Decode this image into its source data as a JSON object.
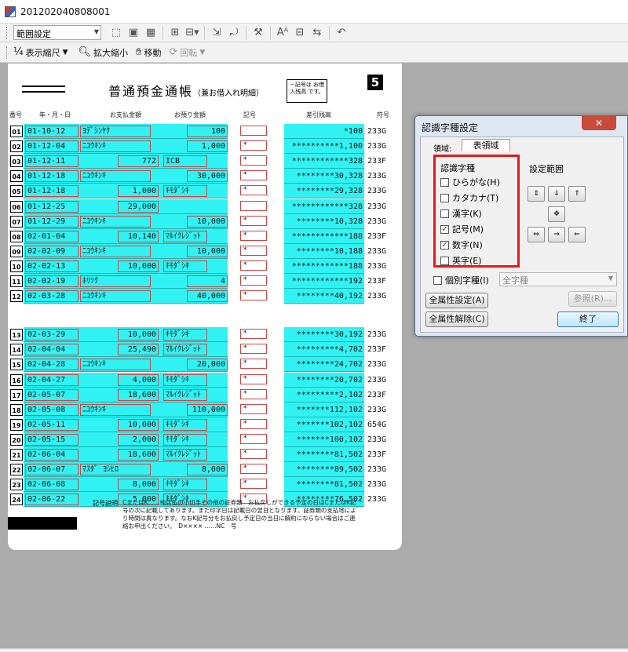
{
  "window": {
    "title": "201202040808001"
  },
  "toolbar1": {
    "range_select": "範囲設定"
  },
  "toolbar2": {
    "display_scale": "表示縮尺",
    "zoom": "拡大縮小",
    "move": "移動",
    "rotate": "回転"
  },
  "document": {
    "title": "普通預金通帳",
    "subtitle": "（兼お借入れ明細）",
    "note_box": "－記号は お借入残高 です。",
    "page_number": "5",
    "headers": {
      "num": "番号",
      "date": "年・月・日",
      "desc": "お支払金額",
      "deposit": "お預り金額",
      "mark": "記号",
      "balance": "差引残高",
      "code": "符号"
    },
    "rows": [
      {
        "n": "01",
        "date": "01-10-12",
        "desc1": "ﾖﾃﾞｼﾝﾔｸ",
        "amt1": "",
        "desc2": "",
        "amt2": "100",
        "mark": "",
        "balance": "*100",
        "code": "233G"
      },
      {
        "n": "02",
        "date": "01-12-04",
        "desc1": "ﾆﾕｳｷﾝｷ",
        "amt1": "",
        "desc2": "",
        "amt2": "1,000",
        "mark": "*",
        "balance": "**********1,100",
        "code": "233G"
      },
      {
        "n": "03",
        "date": "01-12-11",
        "desc1": "",
        "amt1": "772",
        "desc2": "ICB",
        "amt2": "",
        "mark": "*",
        "balance": "************328",
        "code": "233F"
      },
      {
        "n": "04",
        "date": "01-12-18",
        "desc1": "ﾆﾕｳｷﾝｷ",
        "amt1": "",
        "desc2": "",
        "amt2": "30,000",
        "mark": "*",
        "balance": "********30,328",
        "code": "233G"
      },
      {
        "n": "05",
        "date": "01-12-18",
        "desc1": "",
        "amt1": "1,000",
        "desc2": "ｷﾓﾀﾞｼｷ",
        "amt2": "",
        "mark": "*",
        "balance": "********29,328",
        "code": "233G"
      },
      {
        "n": "06",
        "date": "01-12-25",
        "desc1": "",
        "amt1": "29,000",
        "desc2": "",
        "amt2": "",
        "mark": "",
        "balance": "************328",
        "code": "233G"
      },
      {
        "n": "07",
        "date": "01-12-29",
        "desc1": "ﾆﾕｳｷﾝｷ",
        "amt1": "",
        "desc2": "",
        "amt2": "10,000",
        "mark": "*",
        "balance": "********10,328",
        "code": "233G"
      },
      {
        "n": "08",
        "date": "02-01-04",
        "desc1": "",
        "amt1": "10,140",
        "desc2": "ﾏﾙｲｸﾚｼﾞｯﾄ",
        "amt2": "",
        "mark": "*",
        "balance": "************188",
        "code": "233F"
      },
      {
        "n": "09",
        "date": "02-02-09",
        "desc1": "ﾆﾕｳｷﾝｷ",
        "amt1": "",
        "desc2": "",
        "amt2": "10,000",
        "mark": "*",
        "balance": "********10,188",
        "code": "233G"
      },
      {
        "n": "10",
        "date": "02-02-13",
        "desc1": "",
        "amt1": "10,000",
        "desc2": "ｷﾓﾀﾞｼｷ",
        "amt2": "",
        "mark": "*",
        "balance": "************188",
        "code": "233G"
      },
      {
        "n": "11",
        "date": "02-02-19",
        "desc1": "ﾎﾘｿｸ",
        "amt1": "",
        "desc2": "",
        "amt2": "4",
        "mark": "*",
        "balance": "************192",
        "code": "233F"
      },
      {
        "n": "12",
        "date": "02-03-28",
        "desc1": "ﾆﾕｳｷﾝｷ",
        "amt1": "",
        "desc2": "",
        "amt2": "40,000",
        "mark": "*",
        "balance": "********40,192",
        "code": "233G"
      },
      {
        "n": "13",
        "date": "02-03-29",
        "desc1": "",
        "amt1": "10,000",
        "desc2": "ｷﾓﾀﾞｼｷ",
        "amt2": "",
        "mark": "*",
        "balance": "********30,192",
        "code": "233G"
      },
      {
        "n": "14",
        "date": "02-04-04",
        "desc1": "",
        "amt1": "25,490",
        "desc2": "ﾏﾙｲｸﾚｼﾞｯﾄ",
        "amt2": "",
        "mark": "*",
        "balance": "*********4,702",
        "code": "233F"
      },
      {
        "n": "15",
        "date": "02-04-28",
        "desc1": "ﾆﾕｳｷﾝｷ",
        "amt1": "",
        "desc2": "",
        "amt2": "20,000",
        "mark": "*",
        "balance": "********24,702",
        "code": "233G"
      },
      {
        "n": "16",
        "date": "02-04-27",
        "desc1": "",
        "amt1": "4,000",
        "desc2": "ｷﾓﾀﾞｼｷ",
        "amt2": "",
        "mark": "*",
        "balance": "********20,702",
        "code": "233G"
      },
      {
        "n": "17",
        "date": "02-05-07",
        "desc1": "",
        "amt1": "18,600",
        "desc2": "ﾏﾙｲｸﾚｼﾞｯﾄ",
        "amt2": "",
        "mark": "*",
        "balance": "*********2,102",
        "code": "233F"
      },
      {
        "n": "18",
        "date": "02-05-08",
        "desc1": "ﾆﾕｳｷﾝｷ",
        "amt1": "",
        "desc2": "",
        "amt2": "110,000",
        "mark": "*",
        "balance": "*******112,102",
        "code": "233G"
      },
      {
        "n": "19",
        "date": "02-05-11",
        "desc1": "",
        "amt1": "10,000",
        "desc2": "ｷﾓﾀﾞｼｷ",
        "amt2": "",
        "mark": "*",
        "balance": "*******102,102",
        "code": "654G"
      },
      {
        "n": "20",
        "date": "02-05-15",
        "desc1": "",
        "amt1": "2,000",
        "desc2": "ｷﾓﾀﾞｼｷ",
        "amt2": "",
        "mark": "*",
        "balance": "*******100,102",
        "code": "233G"
      },
      {
        "n": "21",
        "date": "02-06-04",
        "desc1": "",
        "amt1": "18,600",
        "desc2": "ﾏﾙｲｸﾚｼﾞｯﾄ",
        "amt2": "",
        "mark": "*",
        "balance": "********81,502",
        "code": "233F"
      },
      {
        "n": "22",
        "date": "02-06-07",
        "desc1": "ﾏｽﾀﾞ ﾖｼﾋﾛ",
        "amt1": "",
        "desc2": "",
        "amt2": "8,000",
        "mark": "*",
        "balance": "********89,502",
        "code": "233G"
      },
      {
        "n": "23",
        "date": "02-06-08",
        "desc1": "",
        "amt1": "8,000",
        "desc2": "ｷﾓﾀﾞｼｷ",
        "amt2": "",
        "mark": "*",
        "balance": "********81,502",
        "code": "233G"
      },
      {
        "n": "24",
        "date": "02-06-22",
        "desc1": "",
        "amt1": "5,000",
        "desc2": "ｷﾓﾀﾞｼｷ",
        "amt2": "",
        "mark": "*",
        "balance": "********76,502",
        "code": "233G"
      }
    ],
    "footer_label": "記号説明",
    "footer_text": "CまたはK……他店払の小切手その他の証券類　お払戻しができる予定の日はCまたはK記号の次に記載してあります。また印字日は記載日の翌日となります。証券類の支払地により時間は異なります。なおK記号分をお払戻し予定日の当日に解約にならない場合はご連絡お申出ください。　D×××× ……NC　号"
  },
  "dialog": {
    "title": "認識字種設定",
    "region_label": "領域:",
    "region_tab": "表領域",
    "group_title": "認識字種",
    "checkboxes": [
      {
        "label": "ひらがな(H)",
        "checked": false
      },
      {
        "label": "カタカナ(T)",
        "checked": false
      },
      {
        "label": "漢字(K)",
        "checked": false
      },
      {
        "label": "記号(M)",
        "checked": true
      },
      {
        "label": "数字(N)",
        "checked": true
      },
      {
        "label": "英字(E)",
        "checked": false
      }
    ],
    "range_title": "設定範囲",
    "individual_label": "個別字種(I)",
    "individual_select": "全字種",
    "btn_set_all": "全属性設定(A)",
    "btn_clear_all": "全属性解除(C)",
    "btn_reference": "参照(R)...",
    "btn_done": "終了",
    "close_symbol": "✕",
    "checkmark": "✓"
  }
}
